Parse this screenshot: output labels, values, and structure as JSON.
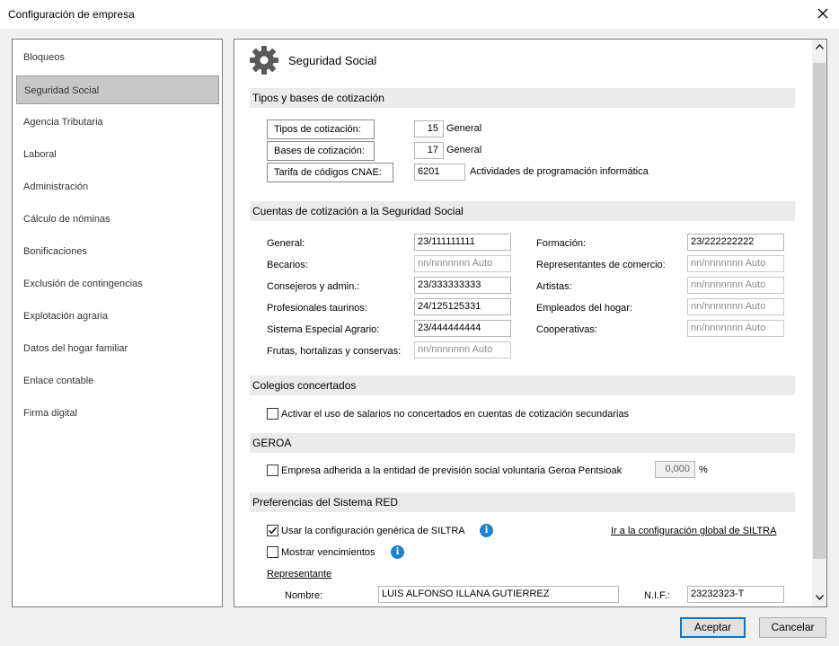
{
  "window": {
    "title": "Configuración de empresa",
    "close_icon": "close-icon"
  },
  "sidebar": {
    "items": [
      {
        "label": "Bloqueos",
        "selected": false
      },
      {
        "label": "Seguridad Social",
        "selected": true
      },
      {
        "label": "Agencia Tributaria",
        "selected": false
      },
      {
        "label": "Laboral",
        "selected": false
      },
      {
        "label": "Administración",
        "selected": false
      },
      {
        "label": "Cálculo de nóminas",
        "selected": false
      },
      {
        "label": "Bonificaciones",
        "selected": false
      },
      {
        "label": "Exclusión de contingencias",
        "selected": false
      },
      {
        "label": "Explotación agraria",
        "selected": false
      },
      {
        "label": "Datos del hogar familiar",
        "selected": false
      },
      {
        "label": "Enlace contable",
        "selected": false
      },
      {
        "label": "Firma digital",
        "selected": false
      }
    ]
  },
  "panel": {
    "title": "Seguridad Social",
    "icon": "gear-icon"
  },
  "tipos_bases": {
    "heading": "Tipos y bases de cotización",
    "tipos": {
      "button_label": "Tipos de cotización:",
      "value": "15",
      "desc": "General"
    },
    "bases": {
      "button_label": "Bases de cotización:",
      "value": "17",
      "desc": "General"
    },
    "cnae": {
      "button_label": "Tarifa de códigos CNAE:",
      "value": "6201",
      "desc": "Actividades de programación informática"
    }
  },
  "cuentas": {
    "heading": "Cuentas de cotización a la Seguridad Social",
    "left": [
      {
        "label": "General:",
        "value": "23/111111111",
        "placeholder": false
      },
      {
        "label": "Becarios:",
        "value": "nn/nnnnnnn Auto",
        "placeholder": true
      },
      {
        "label": "Consejeros y admin.:",
        "value": "23/333333333",
        "placeholder": false
      },
      {
        "label": "Profesionales taurinos:",
        "value": "24/125125331",
        "placeholder": false
      },
      {
        "label": "Sistema Especial Agrario:",
        "value": "23/444444444",
        "placeholder": false
      },
      {
        "label": "Frutas, hortalizas y conservas:",
        "value": "nn/nnnnnnn Auto",
        "placeholder": true
      }
    ],
    "right": [
      {
        "label": "Formación:",
        "value": "23/222222222",
        "placeholder": false
      },
      {
        "label": "Representantes de comercio:",
        "value": "nn/nnnnnnn Auto",
        "placeholder": true
      },
      {
        "label": "Artistas:",
        "value": "nn/nnnnnnn Auto",
        "placeholder": true
      },
      {
        "label": "Empleados del hogar:",
        "value": "nn/nnnnnnn Auto",
        "placeholder": true
      },
      {
        "label": "Cooperativas:",
        "value": "nn/nnnnnnn Auto",
        "placeholder": true
      }
    ]
  },
  "colegios": {
    "heading": "Colegios concertados",
    "checkbox_label": "Activar el uso de salarios no concertados en cuentas de cotización secundarias",
    "checked": false
  },
  "geroa": {
    "heading": "GEROA",
    "checkbox_label": "Empresa adherida a la entidad de previsión social voluntaria Geroa Pentsioak",
    "checked": false,
    "percent_value": "0,000",
    "percent_sign": "%"
  },
  "red": {
    "heading": "Preferencias del Sistema RED",
    "siltra_label": "Usar la configuración genérica de SILTRA",
    "siltra_checked": true,
    "vencimientos_label": "Mostrar vencimientos",
    "vencimientos_checked": false,
    "info_glyph": "i",
    "global_link": "Ir a la configuración global de SILTRA",
    "representante_label": "Representante",
    "nombre_label": "Nombre:",
    "nombre_value": "LUIS ALFONSO ILLANA GUTIERREZ",
    "nif_label": "N.I.F.:",
    "nif_value": "23232323-T"
  },
  "footer": {
    "accept": "Aceptar",
    "cancel": "Cancelar"
  }
}
